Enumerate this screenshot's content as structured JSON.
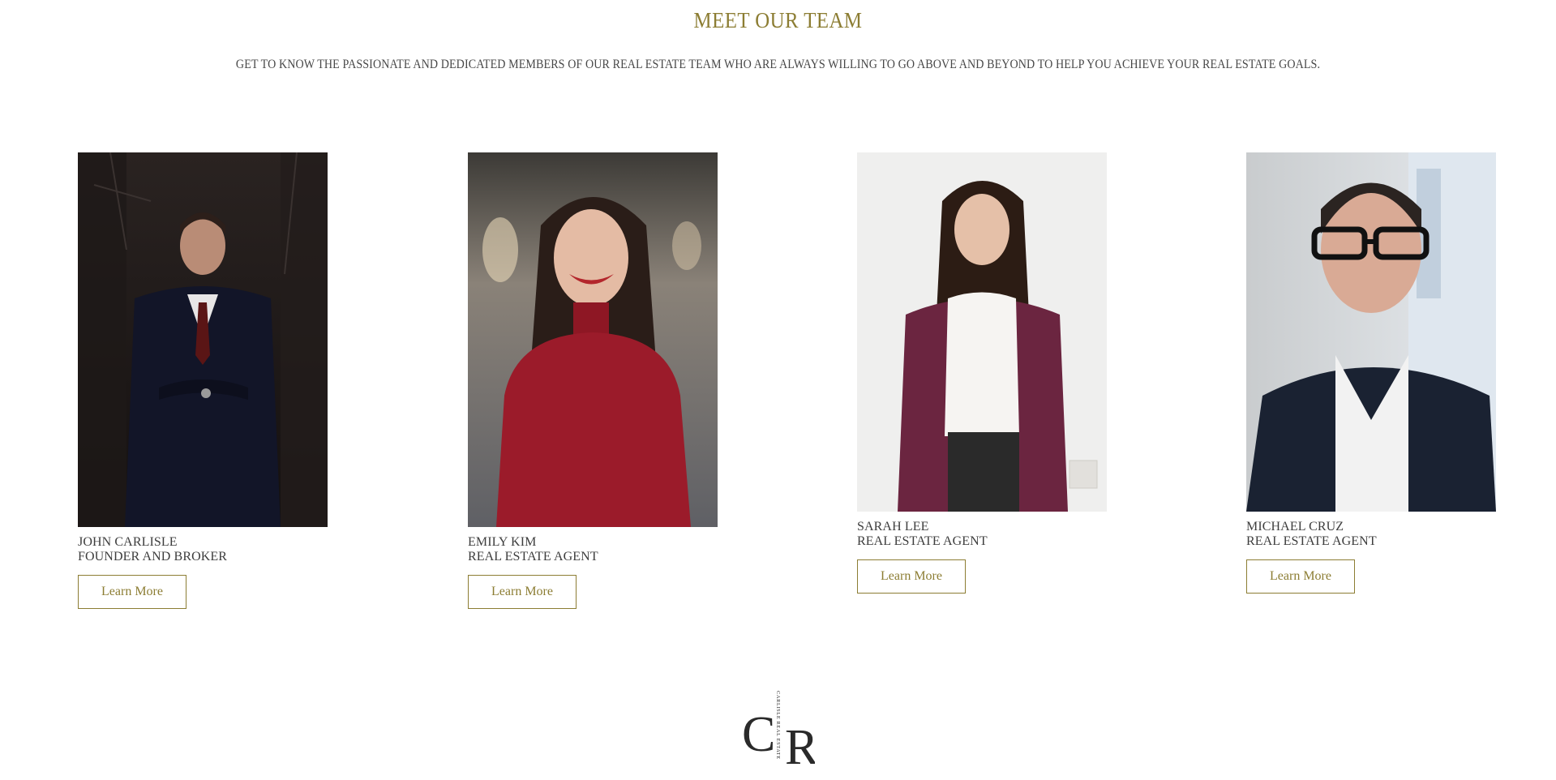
{
  "section": {
    "title": "MEET OUR TEAM",
    "subtitle": "GET TO KNOW THE PASSIONATE AND DEDICATED MEMBERS OF OUR REAL ESTATE TEAM WHO ARE ALWAYS WILLING TO GO ABOVE AND BEYOND TO HELP YOU ACHIEVE YOUR REAL ESTATE GOALS."
  },
  "team": [
    {
      "name": "JOHN CARLISLE",
      "role": "FOUNDER AND BROKER",
      "button_label": "Learn More"
    },
    {
      "name": "EMILY KIM",
      "role": "REAL ESTATE AGENT",
      "button_label": "Learn More"
    },
    {
      "name": "SARAH LEE",
      "role": "REAL ESTATE AGENT",
      "button_label": "Learn More"
    },
    {
      "name": "MICHAEL CRUZ",
      "role": "REAL ESTATE AGENT",
      "button_label": "Learn More"
    }
  ],
  "logo": {
    "letter_1": "C",
    "letter_2": "R",
    "vertical_text": "CARLISLE REAL ESTATE"
  },
  "colors": {
    "accent": "#8c7d33",
    "text": "#3d3d3d",
    "background": "#ffffff"
  }
}
